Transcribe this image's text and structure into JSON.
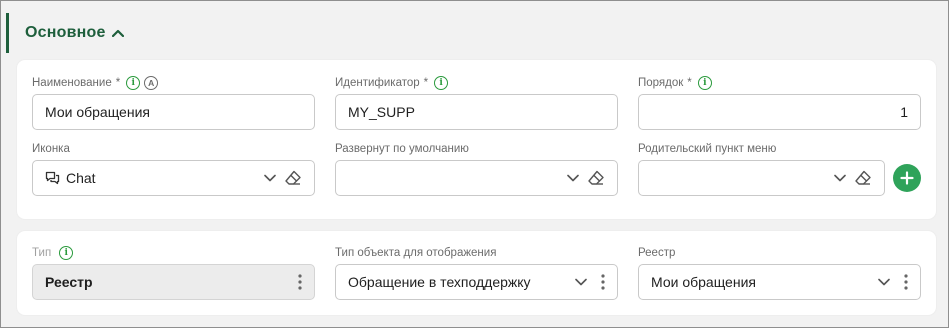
{
  "section": {
    "title": "Основное"
  },
  "fields": {
    "name": {
      "label": "Наименование",
      "required_mark": "*",
      "info_icon": "i",
      "a_icon": "A",
      "value": "Мои обращения"
    },
    "identifier": {
      "label": "Идентификатор",
      "required_mark": "*",
      "info_icon": "i",
      "value": "MY_SUPP"
    },
    "order": {
      "label": "Порядок",
      "required_mark": "*",
      "info_icon": "i",
      "value": "1"
    },
    "icon": {
      "label": "Иконка",
      "value": "Chat",
      "icon_name": "chat-icon"
    },
    "expanded": {
      "label": "Развернут по умолчанию",
      "value": ""
    },
    "parent": {
      "label": "Родительский пункт меню",
      "value": ""
    },
    "type": {
      "label": "Тип",
      "info_icon": "i",
      "value": "Реестр"
    },
    "object_type": {
      "label": "Тип объекта для отображения",
      "value": "Обращение в техподдержку"
    },
    "registry": {
      "label": "Реестр",
      "value": "Мои обращения"
    }
  },
  "colors": {
    "accent_green": "#1e5f3c",
    "info_green": "#2a9a3c",
    "add_button": "#2fa35a",
    "background": "#f2f2f2"
  }
}
